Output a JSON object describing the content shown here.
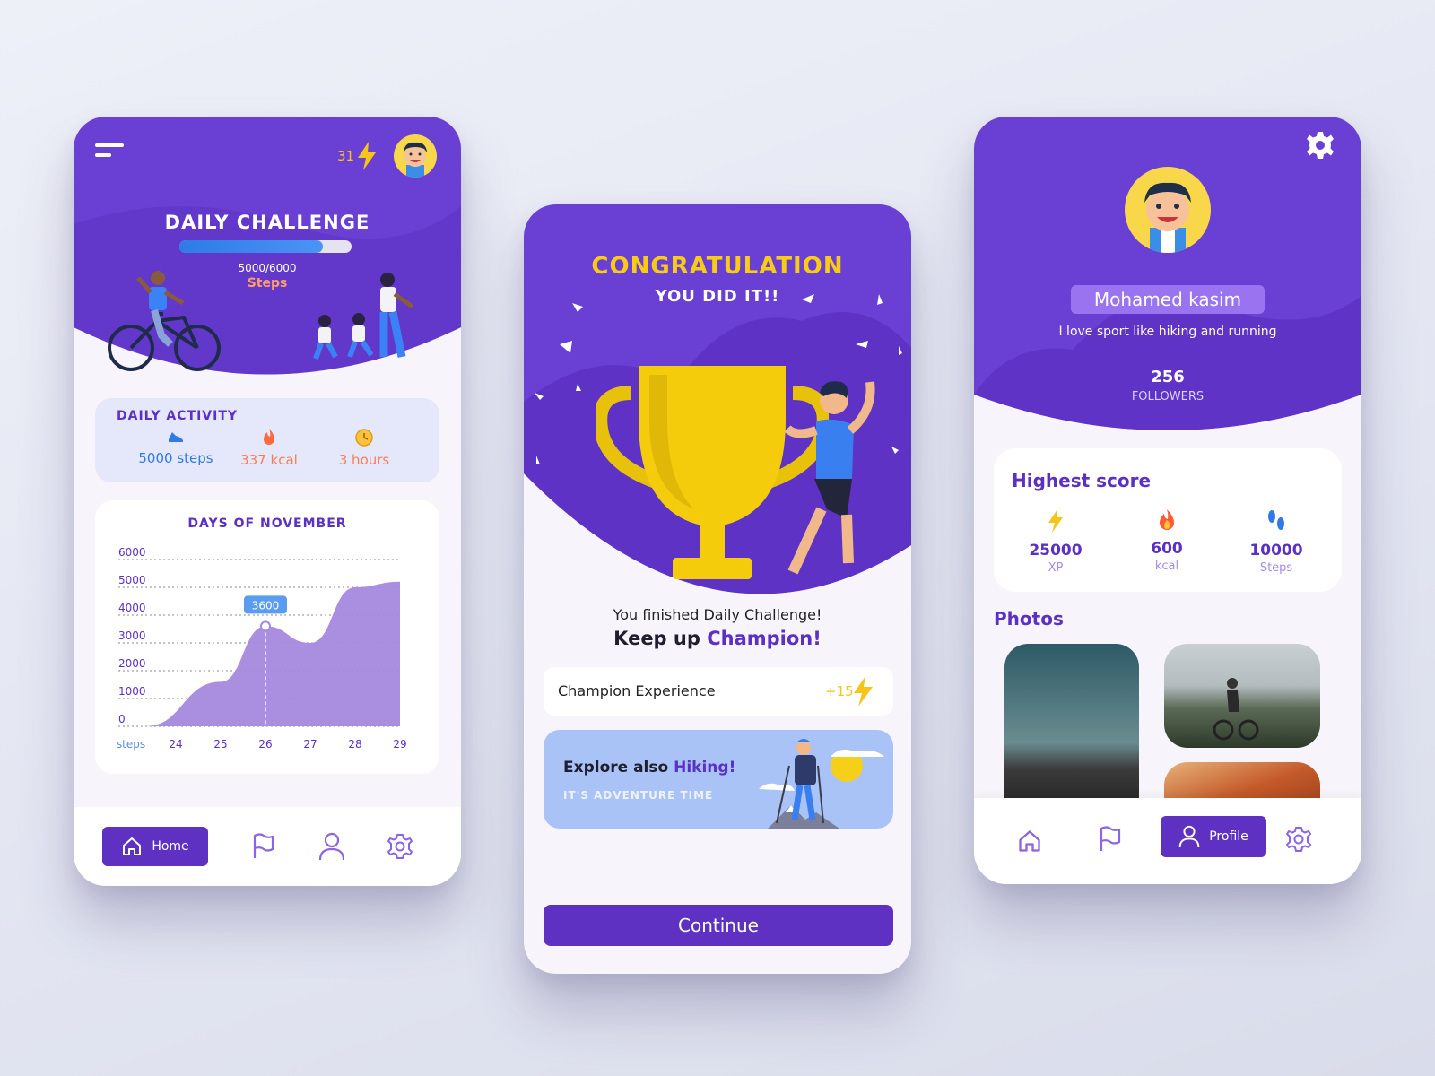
{
  "colors": {
    "primary": "#5f31c2",
    "header_purple": "#6a3fd3",
    "accent_yellow": "#f5c518",
    "steps_blue": "#2f7ae6",
    "kcal_orange": "#ff7b54",
    "chart_fill": "#a589df"
  },
  "home": {
    "streak": "31",
    "header_title": "DAILY CHALLENGE",
    "progress_text": "5000/6000",
    "progress_fraction": 0.833,
    "progress_unit": "Steps",
    "daily_activity": {
      "title": "DAILY ACTIVITY",
      "items": [
        {
          "icon": "shoe-icon",
          "value": "5000 steps",
          "color": "#2f7ae6"
        },
        {
          "icon": "flame-icon",
          "value": "337 kcal",
          "color": "#ff7b54"
        },
        {
          "icon": "clock-icon",
          "value": "3 hours",
          "color": "#ff7b54"
        }
      ]
    },
    "nav": {
      "home_label": "Home"
    }
  },
  "chart_data": {
    "type": "area",
    "title": "DAYS OF NOVEMBER",
    "xlabel": "steps",
    "x": [
      "24",
      "25",
      "26",
      "27",
      "28",
      "29"
    ],
    "y_ticks": [
      "0",
      "1000",
      "2000",
      "3000",
      "4000",
      "5000",
      "6000"
    ],
    "ylim": [
      0,
      6000
    ],
    "series": [
      {
        "values": [
          0,
          1600,
          3600,
          3000,
          5000,
          5200
        ]
      }
    ],
    "annotation": {
      "x": "26",
      "label": "3600"
    },
    "grid": true
  },
  "congrats": {
    "title": "CONGRATULATION",
    "subtitle": "YOU DID IT!!",
    "finished_text": "You finished Daily Challenge!",
    "keep_up": "Keep up",
    "champion": "Champion!",
    "xp_label": "Champion Experience",
    "xp_value": "+15",
    "promo_title_start": "Explore also",
    "promo_title_highlight": "Hiking!",
    "promo_subtitle": "IT'S ADVENTURE TIME",
    "continue_label": "Continue"
  },
  "profile": {
    "name": "Mohamed kasim",
    "bio": "I love sport like hiking and running",
    "followers_count": "256",
    "followers_label": "FOLLOWERS",
    "score_title": "Highest score",
    "scores": [
      {
        "icon": "lightning-icon",
        "value": "25000",
        "label": "XP"
      },
      {
        "icon": "flame-icon",
        "value": "600",
        "label": "kcal"
      },
      {
        "icon": "footprints-icon",
        "value": "10000",
        "label": "Steps"
      }
    ],
    "photos_title": "Photos",
    "nav": {
      "profile_label": "Profile"
    }
  }
}
